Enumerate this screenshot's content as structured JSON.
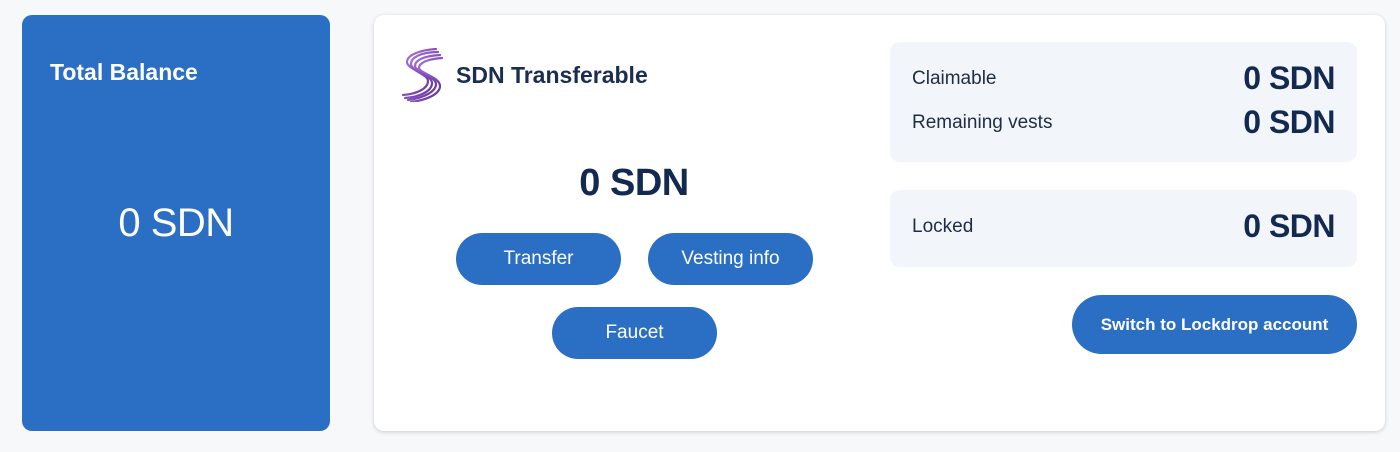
{
  "total_balance": {
    "title": "Total Balance",
    "amount": "0 SDN"
  },
  "transferable": {
    "logo_icon": "shiden-logo-icon",
    "title": "SDN Transferable",
    "amount": "0 SDN",
    "buttons": {
      "transfer": "Transfer",
      "vesting_info": "Vesting info",
      "faucet": "Faucet"
    }
  },
  "vesting": {
    "claimable_label": "Claimable",
    "claimable_value": "0 SDN",
    "remaining_label": "Remaining vests",
    "remaining_value": "0 SDN"
  },
  "locked": {
    "label": "Locked",
    "value": "0 SDN"
  },
  "lockdrop_button": "Switch to Lockdrop account",
  "colors": {
    "background": "#f7f8fa",
    "accent": "#2a6fc3",
    "amount_text": "#13294f",
    "info_box": "#f2f6fa",
    "logo_purple": "#7b3fa8"
  }
}
